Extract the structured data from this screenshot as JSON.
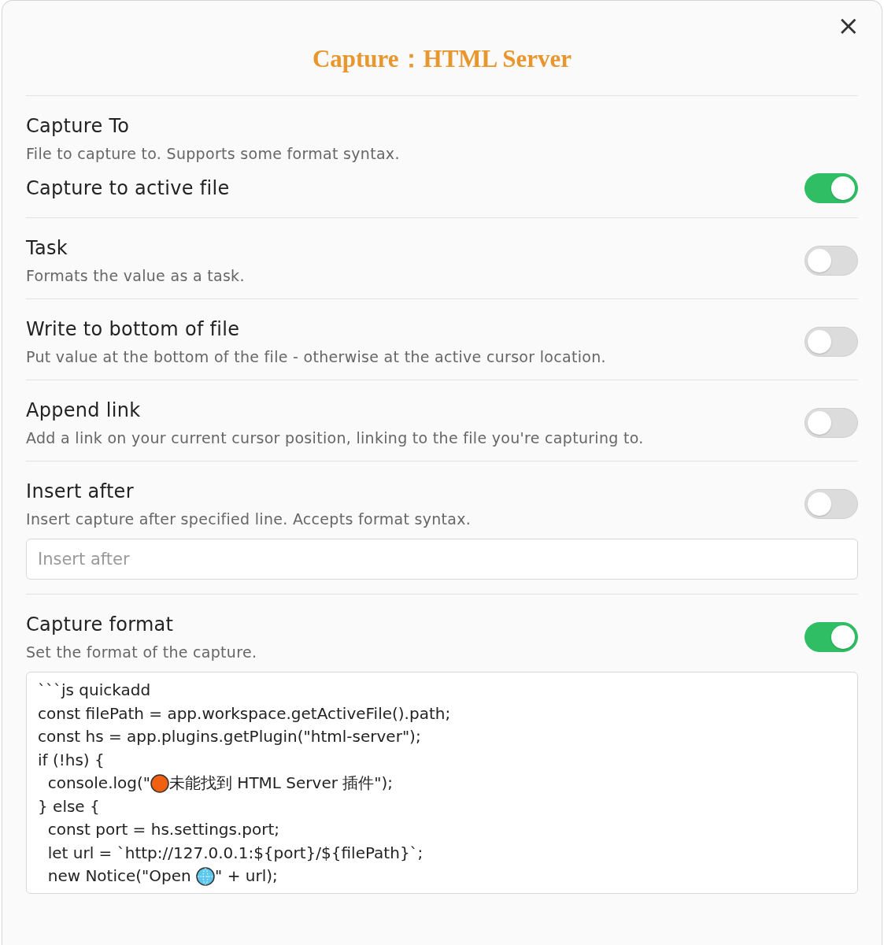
{
  "dialog": {
    "title": "Capture：HTML Server",
    "close": "×"
  },
  "sections": [
    {
      "items": [
        {
          "kind": "setting",
          "name": "Capture To",
          "description": "File to capture to. Supports some format syntax."
        },
        {
          "kind": "setting",
          "name": "Capture to active file",
          "on": true
        }
      ]
    },
    {
      "items": [
        {
          "kind": "setting",
          "name": "Task",
          "description": "Formats the value as a task.",
          "on": false
        }
      ]
    },
    {
      "items": [
        {
          "kind": "setting",
          "name": "Write to bottom of file",
          "description": "Put value at the bottom of the file - otherwise at the active cursor location.",
          "on": false
        }
      ]
    },
    {
      "items": [
        {
          "kind": "setting",
          "name": "Append link",
          "description": "Add a link on your current cursor position, linking to the file you're capturing to.",
          "on": false
        }
      ]
    },
    {
      "items": [
        {
          "kind": "setting",
          "name": "Insert after",
          "description": "Insert capture after specified line. Accepts format syntax.",
          "on": false
        },
        {
          "kind": "input",
          "placeholder": "Insert after"
        }
      ]
    },
    {
      "items": [
        {
          "kind": "setting",
          "name": "Capture format",
          "description": "Set the format of the capture.",
          "on": true
        },
        {
          "kind": "code",
          "lines": [
            [
              {
                "kind": "text",
                "text": "```js quickadd"
              }
            ],
            [
              {
                "kind": "text",
                "text": "const filePath = app.workspace.getActiveFile().path;"
              }
            ],
            [
              {
                "kind": "text",
                "text": "const hs = app.plugins.getPlugin(\"html-server\");"
              }
            ],
            [
              {
                "kind": "text",
                "text": "if (!hs) {"
              }
            ],
            [
              {
                "kind": "text",
                "text": "  console.log(\""
              },
              {
                "kind": "dot"
              },
              {
                "kind": "text",
                "text": "未能找到 HTML Server 插件\");"
              }
            ],
            [
              {
                "kind": "text",
                "text": "} else {"
              }
            ],
            [
              {
                "kind": "text",
                "text": "  const port = hs.settings.port;"
              }
            ],
            [
              {
                "kind": "text",
                "text": "  let url = `http://127.0.0.1:${port}/${filePath}`;"
              }
            ],
            [
              {
                "kind": "text",
                "text": "  new Notice(\"Open "
              },
              {
                "kind": "globe"
              },
              {
                "kind": "text",
                "text": "\" + url);"
              }
            ]
          ]
        }
      ]
    }
  ]
}
